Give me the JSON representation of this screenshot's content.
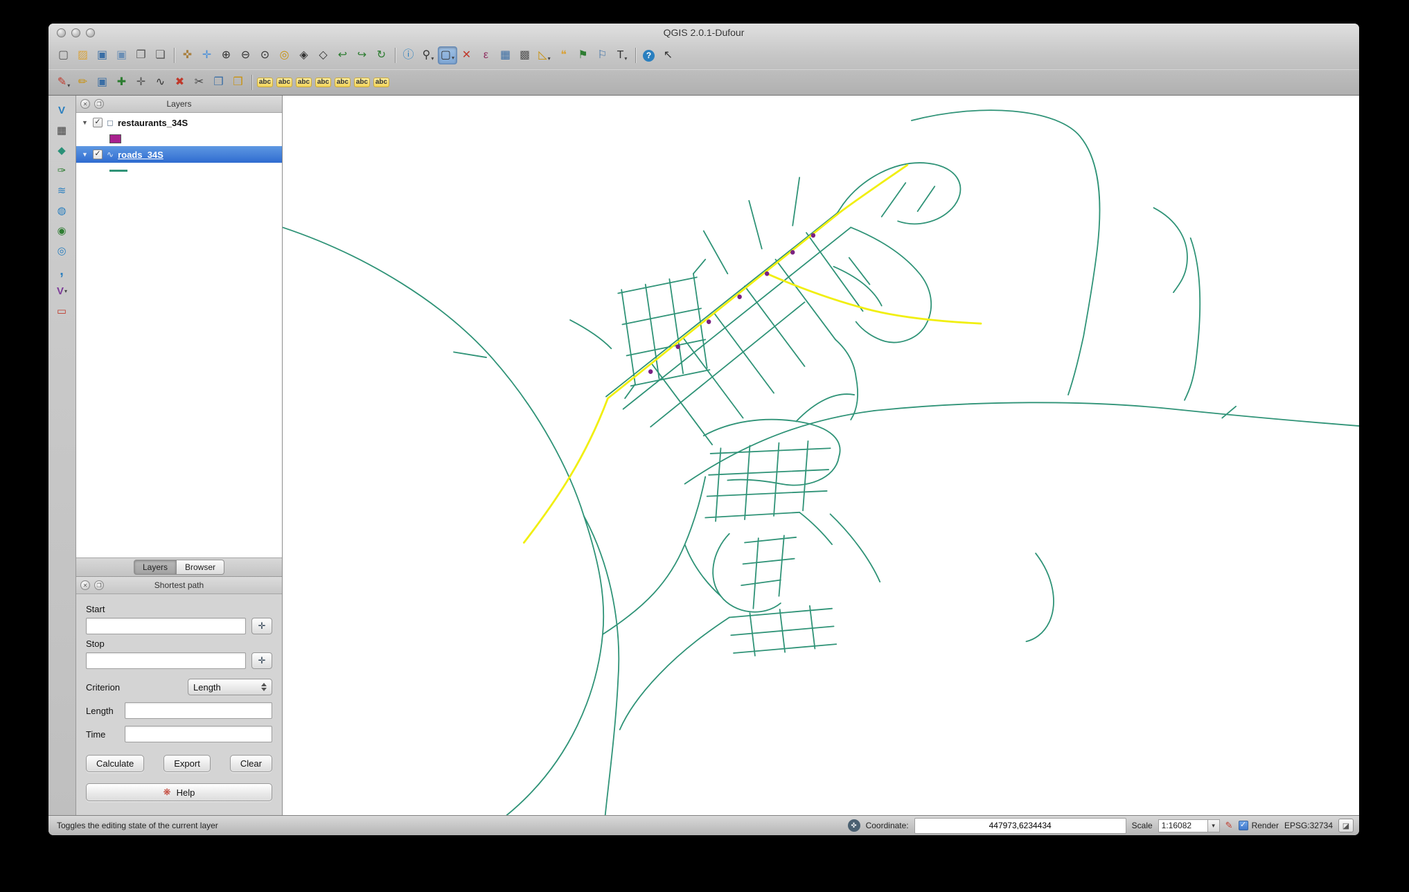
{
  "window": {
    "title": "QGIS 2.0.1-Dufour"
  },
  "glyphs": {
    "expander": "▼",
    "checkmark": "✓",
    "close": "✕",
    "float": "❐",
    "crosshair": "✛",
    "help_badge": "❋",
    "dropdown": "▾",
    "pen": "✎",
    "tracking": "✜",
    "crs": "◪"
  },
  "toolbar_main": {
    "items": [
      {
        "name": "new-project-icon",
        "glyph": "▢",
        "style": "color:#555",
        "inter": "true",
        "cls": "tbtn"
      },
      {
        "name": "open-project-icon",
        "glyph": "▨",
        "style": "color:#d9a33c",
        "inter": "true",
        "cls": "tbtn"
      },
      {
        "name": "save-project-icon",
        "glyph": "▣",
        "style": "color:#3a6ea5",
        "inter": "true",
        "cls": "tbtn"
      },
      {
        "name": "save-project-as-icon",
        "glyph": "▣",
        "style": "color:#6b8fb5",
        "inter": "true",
        "cls": "tbtn"
      },
      {
        "name": "new-composer-icon",
        "glyph": "❐",
        "style": "color:#555",
        "inter": "true",
        "cls": "tbtn"
      },
      {
        "name": "composer-manager-icon",
        "glyph": "❏",
        "style": "color:#555",
        "inter": "true",
        "cls": "tbtn"
      },
      {
        "name": "toolbar-separator",
        "glyph": "",
        "style": "",
        "inter": "false",
        "cls": "tsep"
      },
      {
        "name": "pan-map-icon",
        "glyph": "✜",
        "style": "color:#a9803f",
        "inter": "true",
        "cls": "tbtn"
      },
      {
        "name": "pan-to-selection-icon",
        "glyph": "✛",
        "style": "color:#4a90d9",
        "inter": "true",
        "cls": "tbtn"
      },
      {
        "name": "zoom-in-icon",
        "glyph": "⊕",
        "style": "color:#333",
        "inter": "true",
        "cls": "tbtn"
      },
      {
        "name": "zoom-out-icon",
        "glyph": "⊖",
        "style": "color:#333",
        "inter": "true",
        "cls": "tbtn"
      },
      {
        "name": "zoom-actual-size-icon",
        "glyph": "⊙",
        "style": "color:#333",
        "inter": "true",
        "cls": "tbtn"
      },
      {
        "name": "zoom-full-extent-icon",
        "glyph": "◎",
        "style": "color:#c9920e",
        "inter": "true",
        "cls": "tbtn"
      },
      {
        "name": "zoom-to-selection-icon",
        "glyph": "◈",
        "style": "color:#333",
        "inter": "true",
        "cls": "tbtn"
      },
      {
        "name": "zoom-to-layer-icon",
        "glyph": "◇",
        "style": "color:#333",
        "inter": "true",
        "cls": "tbtn"
      },
      {
        "name": "zoom-last-icon",
        "glyph": "↩",
        "style": "color:#2e7d32",
        "inter": "true",
        "cls": "tbtn"
      },
      {
        "name": "zoom-next-icon",
        "glyph": "↪",
        "style": "color:#2e7d32",
        "inter": "true",
        "cls": "tbtn"
      },
      {
        "name": "refresh-map-icon",
        "glyph": "↻",
        "style": "color:#2e7d32",
        "inter": "true",
        "cls": "tbtn"
      },
      {
        "name": "toolbar-separator",
        "glyph": "",
        "style": "",
        "inter": "false",
        "cls": "tsep"
      },
      {
        "name": "identify-features-icon",
        "glyph": "ⓘ",
        "style": "color:#2a7fbf",
        "inter": "true",
        "cls": "tbtn"
      },
      {
        "name": "zoom-tools-menu-icon",
        "glyph": "⚲",
        "style": "color:#333",
        "caret": "▾",
        "inter": "true",
        "cls": "tbtn"
      },
      {
        "name": "select-features-icon",
        "glyph": "▢",
        "style": "color:#333",
        "caret": "▾",
        "inter": "true",
        "cls": "tbtn active"
      },
      {
        "name": "deselect-features-icon",
        "glyph": "✕",
        "style": "color:#c0392b",
        "inter": "true",
        "cls": "tbtn"
      },
      {
        "name": "select-by-expression-icon",
        "glyph": "ε",
        "style": "color:#8e2c5e",
        "inter": "true",
        "cls": "tbtn"
      },
      {
        "name": "attribute-table-icon",
        "glyph": "▦",
        "style": "color:#3a6ea5",
        "inter": "true",
        "cls": "tbtn"
      },
      {
        "name": "field-calculator-icon",
        "glyph": "▩",
        "style": "color:#555",
        "inter": "true",
        "cls": "tbtn"
      },
      {
        "name": "measure-icon",
        "glyph": "◺",
        "style": "color:#c9920e",
        "caret": "▾",
        "inter": "true",
        "cls": "tbtn"
      },
      {
        "name": "map-tips-icon",
        "glyph": "❝",
        "style": "color:#d9a33c",
        "inter": "true",
        "cls": "tbtn"
      },
      {
        "name": "new-bookmark-icon",
        "glyph": "⚑",
        "style": "color:#2e7d32",
        "inter": "true",
        "cls": "tbtn"
      },
      {
        "name": "show-bookmarks-icon",
        "glyph": "⚐",
        "style": "color:#3a6ea5",
        "inter": "true",
        "cls": "tbtn"
      },
      {
        "name": "text-annotation-icon",
        "glyph": "T",
        "style": "color:#333",
        "caret": "▾",
        "inter": "true",
        "cls": "tbtn"
      },
      {
        "name": "toolbar-separator",
        "glyph": "",
        "style": "",
        "inter": "false",
        "cls": "tsep"
      },
      {
        "name": "help-icon",
        "glyph": "?",
        "style": "",
        "inter": "true",
        "cls": "tbtn helpbtn"
      },
      {
        "name": "whats-this-icon",
        "glyph": "↖",
        "style": "color:#333",
        "inter": "true",
        "cls": "tbtn"
      }
    ]
  },
  "toolbar_edit": {
    "items": [
      {
        "name": "current-edits-icon",
        "glyph": "✎",
        "style": "color:#c0392b",
        "caret": "▾",
        "inter": "true",
        "cls": "tbtn"
      },
      {
        "name": "toggle-editing-icon",
        "glyph": "✏",
        "style": "color:#c9920e",
        "inter": "true",
        "cls": "tbtn"
      },
      {
        "name": "save-layer-edits-icon",
        "glyph": "▣",
        "style": "color:#3a6ea5",
        "inter": "true",
        "cls": "tbtn"
      },
      {
        "name": "add-feature-icon",
        "glyph": "✚",
        "style": "color:#2e7d32",
        "inter": "true",
        "cls": "tbtn"
      },
      {
        "name": "move-feature-icon",
        "glyph": "✛",
        "style": "color:#555",
        "inter": "true",
        "cls": "tbtn"
      },
      {
        "name": "node-tool-icon",
        "glyph": "∿",
        "style": "color:#333",
        "inter": "true",
        "cls": "tbtn"
      },
      {
        "name": "delete-selected-icon",
        "glyph": "✖",
        "style": "color:#c0392b",
        "inter": "true",
        "cls": "tbtn"
      },
      {
        "name": "cut-features-icon",
        "glyph": "✂",
        "style": "color:#444",
        "inter": "true",
        "cls": "tbtn"
      },
      {
        "name": "copy-features-icon",
        "glyph": "❐",
        "style": "color:#3a6ea5",
        "inter": "true",
        "cls": "tbtn"
      },
      {
        "name": "paste-features-icon",
        "glyph": "❒",
        "style": "color:#c9920e",
        "inter": "true",
        "cls": "tbtn"
      },
      {
        "name": "toolbar-separator",
        "glyph": "",
        "style": "",
        "inter": "false",
        "cls": "tsep"
      },
      {
        "name": "labeling-options-icon",
        "glyph": "abc",
        "style": "",
        "inter": "true",
        "cls": "tbtn abcbtn"
      },
      {
        "name": "pin-labels-icon",
        "glyph": "abc",
        "style": "",
        "inter": "true",
        "cls": "tbtn abcbtn"
      },
      {
        "name": "highlight-pinned-labels-icon",
        "glyph": "abc",
        "style": "",
        "inter": "true",
        "cls": "tbtn abcbtn"
      },
      {
        "name": "show-hide-labels-icon",
        "glyph": "abc",
        "style": "",
        "inter": "true",
        "cls": "tbtn abcbtn"
      },
      {
        "name": "move-label-icon",
        "glyph": "abc",
        "style": "",
        "inter": "true",
        "cls": "tbtn abcbtn"
      },
      {
        "name": "rotate-label-icon",
        "glyph": "abc",
        "style": "",
        "inter": "true",
        "cls": "tbtn abcbtn"
      },
      {
        "name": "change-label-icon",
        "glyph": "abc",
        "style": "",
        "inter": "true",
        "cls": "tbtn abcbtn"
      }
    ]
  },
  "layer_toolbar": {
    "items": [
      {
        "name": "add-vector-layer-icon",
        "glyph": "V",
        "style": "color:#2a7fbf;font-weight:bold",
        "inter": "true",
        "cls": "vbtn"
      },
      {
        "name": "add-raster-layer-icon",
        "glyph": "▦",
        "style": "color:#444",
        "inter": "true",
        "cls": "vbtn"
      },
      {
        "name": "add-postgis-layer-icon",
        "glyph": "◆",
        "style": "color:#2a9178",
        "inter": "true",
        "cls": "vbtn"
      },
      {
        "name": "add-spatialite-layer-icon",
        "glyph": "✑",
        "style": "color:#2e7d32",
        "inter": "true",
        "cls": "vbtn"
      },
      {
        "name": "add-mssql-layer-icon",
        "glyph": "≋",
        "style": "color:#2a7fbf",
        "inter": "true",
        "cls": "vbtn"
      },
      {
        "name": "add-wms-layer-icon",
        "glyph": "◍",
        "style": "color:#2a7fbf",
        "inter": "true",
        "cls": "vbtn"
      },
      {
        "name": "add-wcs-layer-icon",
        "glyph": "◉",
        "style": "color:#2e7d32",
        "inter": "true",
        "cls": "vbtn"
      },
      {
        "name": "add-wfs-layer-icon",
        "glyph": "◎",
        "style": "color:#2a7fbf",
        "inter": "true",
        "cls": "vbtn"
      },
      {
        "name": "add-delimited-text-icon",
        "glyph": ",",
        "style": "color:#2a7fbf;font-weight:bold;font-size:20px",
        "inter": "true",
        "cls": "vbtn"
      },
      {
        "name": "new-shapefile-layer-icon",
        "glyph": "V",
        "style": "color:#7d3c98;font-weight:bold",
        "caret": "▾",
        "inter": "true",
        "cls": "vbtn"
      },
      {
        "name": "remove-layer-icon",
        "glyph": "▭",
        "style": "color:#c0392b",
        "inter": "true",
        "cls": "vbtn"
      }
    ]
  },
  "layers_panel": {
    "title": "Layers",
    "layers": [
      {
        "name": "restaurants_34S",
        "icon": "◻",
        "swatch_style": "background:#a8218e"
      },
      {
        "name": "roads_34S",
        "icon": "∿",
        "swatch_style": "background:#2f9377"
      }
    ],
    "tabs": [
      {
        "label": "Layers",
        "cls": "ptab active",
        "dn": "tab-layers"
      },
      {
        "label": "Browser",
        "cls": "ptab",
        "dn": "tab-browser"
      }
    ]
  },
  "shortest_path": {
    "title": "Shortest path",
    "start_label": "Start",
    "start_value": "",
    "stop_label": "Stop",
    "stop_value": "",
    "criterion_label": "Criterion",
    "criterion_value": "Length",
    "length_label": "Length",
    "length_value": "",
    "time_label": "Time",
    "time_value": "",
    "calculate_label": "Calculate",
    "export_label": "Export",
    "clear_label": "Clear",
    "help_label": "Help"
  },
  "statusbar": {
    "hint": "Toggles the editing state of the current layer",
    "coordinate_label": "Coordinate:",
    "coordinate_value": "447973,6234434",
    "scale_label": "Scale",
    "scale_value": "1:16082",
    "render_label": "Render",
    "crs_label": "EPSG:32734"
  },
  "map": {
    "background": "#ffffff",
    "road_color": "#2f9377",
    "route_color": "#f1ef10",
    "point_color": "#7a2182"
  }
}
